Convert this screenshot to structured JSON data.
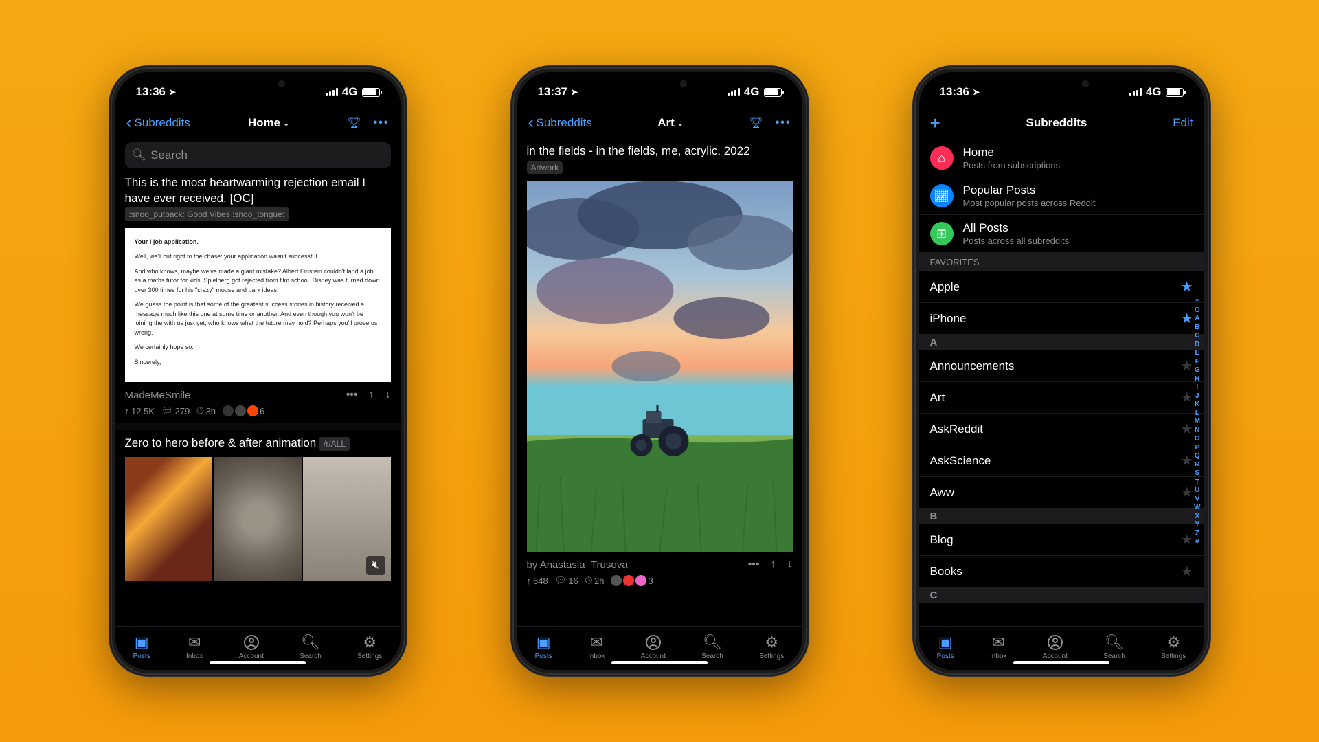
{
  "status": {
    "time1": "13:36",
    "time2": "13:37",
    "time3": "13:36",
    "network": "4G"
  },
  "phone1": {
    "back": "Subreddits",
    "title": "Home",
    "search_placeholder": "Search",
    "post1": {
      "title": "This is the most heartwarming rejection email I have ever received. [OC]",
      "flair": ":snoo_putback: Good Vibes :snoo_tongue:",
      "email_subject": "Your I       job application.",
      "email_p1": "Well, we'll cut right to the chase: your application wasn't successful.",
      "email_p2": "And who knows, maybe we've made a giant mistake? Albert Einstein couldn't land a job as a maths tutor for kids. Spielberg got rejected from film school. Disney was turned down over 300 times for his \"crazy\" mouse and park ideas.",
      "email_p3": "We guess the point is that some of the greatest success stories in history received a message much like this one at some time or another. And even though you won't be joining the                         with us just yet, who knows what the future may hold? Perhaps you'll prove us wrong.",
      "email_p4": "We certainly hope so.",
      "email_p5": "Sincerely,",
      "subreddit": "MadeMeSmile",
      "up": "12.5K",
      "comments": "279",
      "time": "3h",
      "award_count": "6"
    },
    "post2": {
      "title": "Zero to hero before & after animation",
      "flair": "/r/ALL"
    }
  },
  "phone2": {
    "back": "Subreddits",
    "title": "Art",
    "post": {
      "title": "in the fields - in the fields, me, acrylic, 2022",
      "flair": "Artwork",
      "byline_prefix": "by ",
      "author": "Anastasia_Trusova",
      "up": "648",
      "comments": "16",
      "time": "2h",
      "award_count": "3"
    }
  },
  "phone3": {
    "title": "Subreddits",
    "edit": "Edit",
    "feeds": [
      {
        "title": "Home",
        "sub": "Posts from subscriptions",
        "color": "#ff2d55",
        "icon": "home"
      },
      {
        "title": "Popular Posts",
        "sub": "Most popular posts across Reddit",
        "color": "#0a84ff",
        "icon": "trend"
      },
      {
        "title": "All Posts",
        "sub": "Posts across all subreddits",
        "color": "#34c759",
        "icon": "all"
      }
    ],
    "fav_header": "FAVORITES",
    "favorites": [
      "Apple",
      "iPhone"
    ],
    "sectionA": [
      "Announcements",
      "Art",
      "AskReddit",
      "AskScience",
      "Aww"
    ],
    "sectionB": [
      "Blog",
      "Books"
    ],
    "letterA": "A",
    "letterB": "B",
    "letterC": "C"
  },
  "tabs": [
    {
      "label": "Posts",
      "icon": "posts"
    },
    {
      "label": "Inbox",
      "icon": "inbox"
    },
    {
      "label": "Account",
      "icon": "account"
    },
    {
      "label": "Search",
      "icon": "search"
    },
    {
      "label": "Settings",
      "icon": "settings"
    }
  ],
  "index": [
    "≡",
    "O",
    "A",
    "B",
    "C",
    "D",
    "E",
    "F",
    "G",
    "H",
    "I",
    "J",
    "K",
    "L",
    "M",
    "N",
    "O",
    "P",
    "Q",
    "R",
    "S",
    "T",
    "U",
    "V",
    "W",
    "X",
    "Y",
    "Z",
    "#"
  ]
}
